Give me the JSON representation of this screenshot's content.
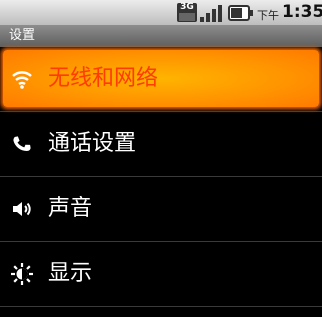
{
  "status_bar": {
    "network_type": "3G",
    "time_period": "下午",
    "time": "1:35"
  },
  "title": "设置",
  "menu": {
    "items": [
      {
        "label": "无线和网络",
        "icon": "wifi-icon",
        "selected": true
      },
      {
        "label": "通话设置",
        "icon": "phone-icon",
        "selected": false
      },
      {
        "label": "声音",
        "icon": "speaker-icon",
        "selected": false
      },
      {
        "label": "显示",
        "icon": "brightness-icon",
        "selected": false
      }
    ]
  },
  "colors": {
    "highlight": "#ff9500",
    "selected_text": "#ff3b00",
    "background": "#000000"
  }
}
